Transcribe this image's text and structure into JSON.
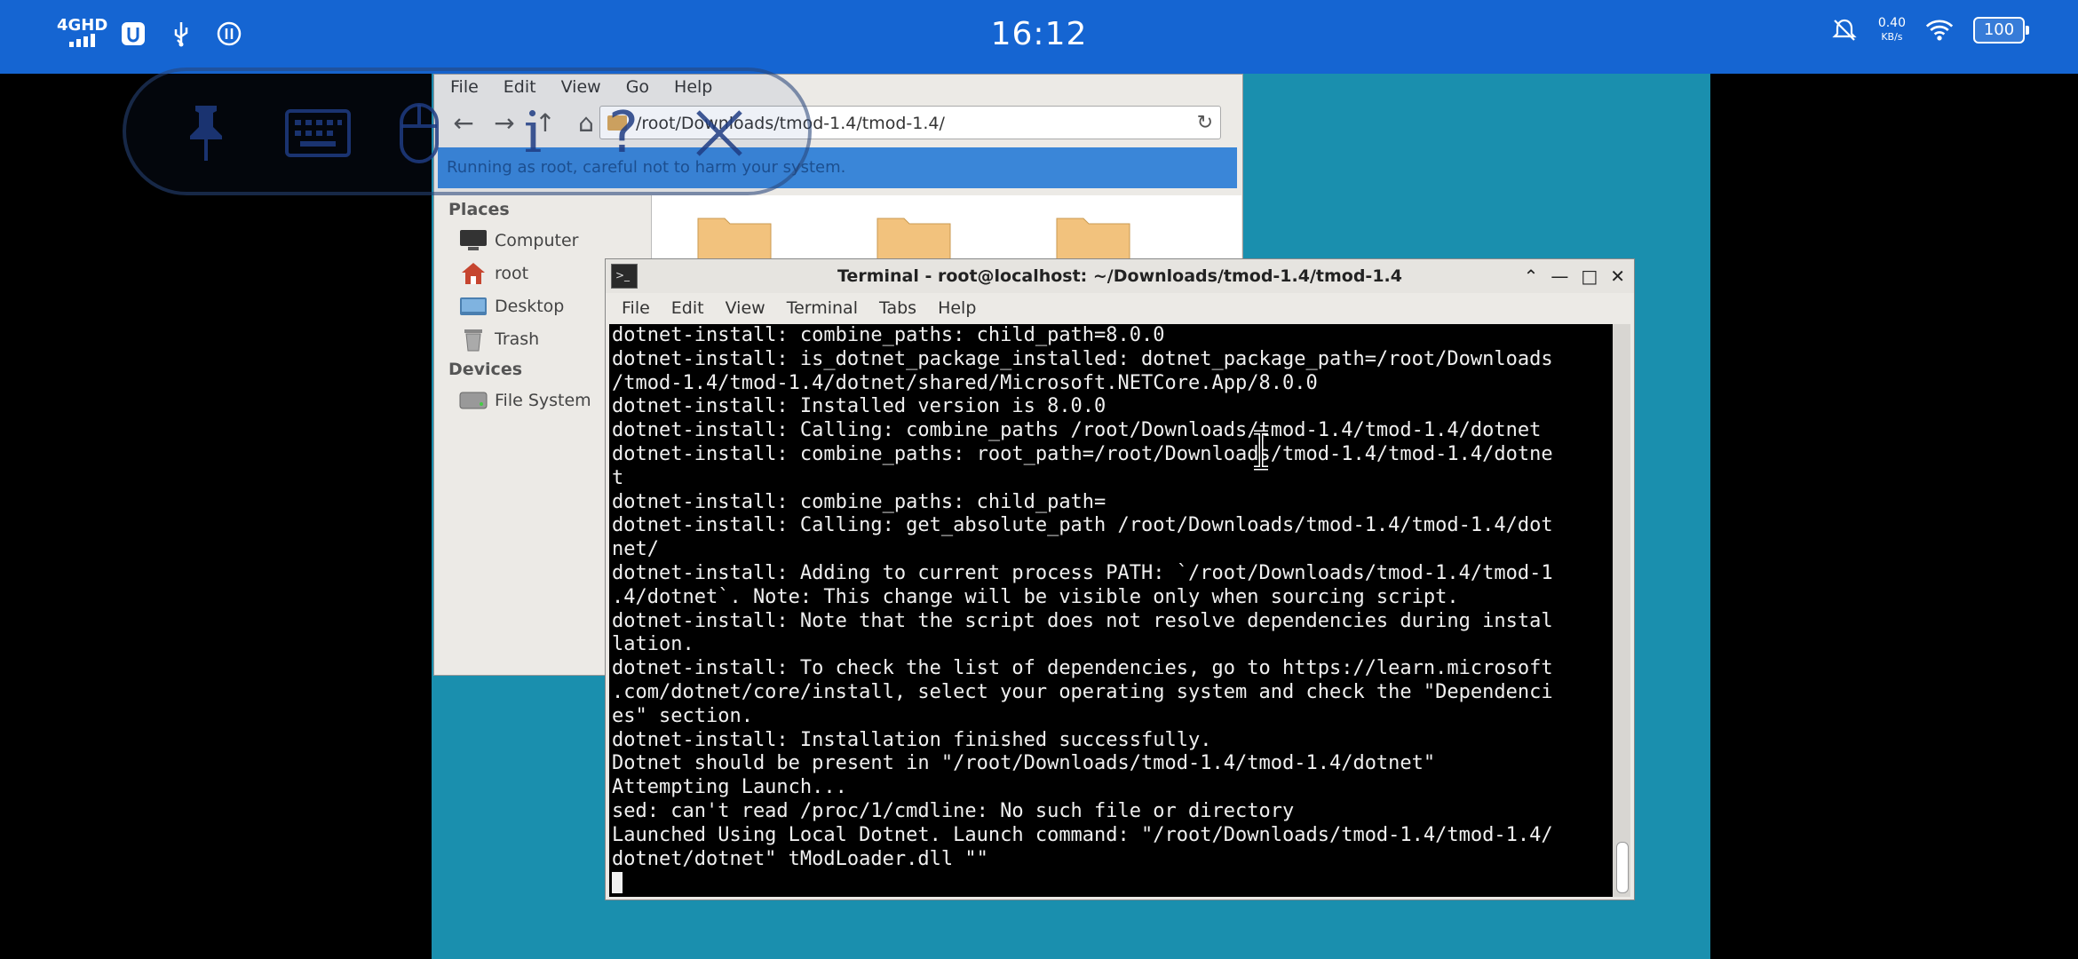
{
  "status_bar": {
    "network": "4GHD",
    "time": "16:12",
    "speed_value": "0.40",
    "speed_unit": "KB/s",
    "battery": "100"
  },
  "overlay_toolbar": {
    "icons": [
      "pin-icon",
      "keyboard-icon",
      "mouse-icon",
      "info-icon",
      "help-icon",
      "close-icon"
    ],
    "info_glyph": "i",
    "help_glyph": "?"
  },
  "file_manager": {
    "menu": [
      "File",
      "Edit",
      "View",
      "Go",
      "Help"
    ],
    "path": "/root/Downloads/tmod-1.4/tmod-1.4/",
    "warning": "Running as root, careful not to harm your system.",
    "places_header": "Places",
    "places": [
      "Computer",
      "root",
      "Desktop",
      "Trash"
    ],
    "devices_header": "Devices",
    "devices": [
      "File System"
    ]
  },
  "terminal": {
    "title": "Terminal - root@localhost: ~/Downloads/tmod-1.4/tmod-1.4",
    "menu": [
      "File",
      "Edit",
      "View",
      "Terminal",
      "Tabs",
      "Help"
    ],
    "lines": [
      "dotnet-install: combine_paths: child_path=8.0.0",
      "dotnet-install: is_dotnet_package_installed: dotnet_package_path=/root/Downloads",
      "/tmod-1.4/tmod-1.4/dotnet/shared/Microsoft.NETCore.App/8.0.0",
      "dotnet-install: Installed version is 8.0.0",
      "dotnet-install: Calling: combine_paths /root/Downloads/tmod-1.4/tmod-1.4/dotnet",
      "dotnet-install: combine_paths: root_path=/root/Downloads/tmod-1.4/tmod-1.4/dotne",
      "t",
      "dotnet-install: combine_paths: child_path=",
      "dotnet-install: Calling: get_absolute_path /root/Downloads/tmod-1.4/tmod-1.4/dot",
      "net/",
      "dotnet-install: Adding to current process PATH: `/root/Downloads/tmod-1.4/tmod-1",
      ".4/dotnet`. Note: This change will be visible only when sourcing script.",
      "dotnet-install: Note that the script does not resolve dependencies during instal",
      "lation.",
      "dotnet-install: To check the list of dependencies, go to https://learn.microsoft",
      ".com/dotnet/core/install, select your operating system and check the \"Dependenci",
      "es\" section.",
      "dotnet-install: Installation finished successfully.",
      "Dotnet should be present in \"/root/Downloads/tmod-1.4/tmod-1.4/dotnet\"",
      "Attempting Launch...",
      "sed: can't read /proc/1/cmdline: No such file or directory",
      "Launched Using Local Dotnet. Launch command: \"/root/Downloads/tmod-1.4/tmod-1.4/",
      "dotnet/dotnet\" tModLoader.dll \"\""
    ]
  },
  "colors": {
    "status_bar": "#1565d2",
    "desktop": "#1a8fae",
    "terminal_bg": "#000000",
    "terminal_fg": "#f0f0f0"
  }
}
